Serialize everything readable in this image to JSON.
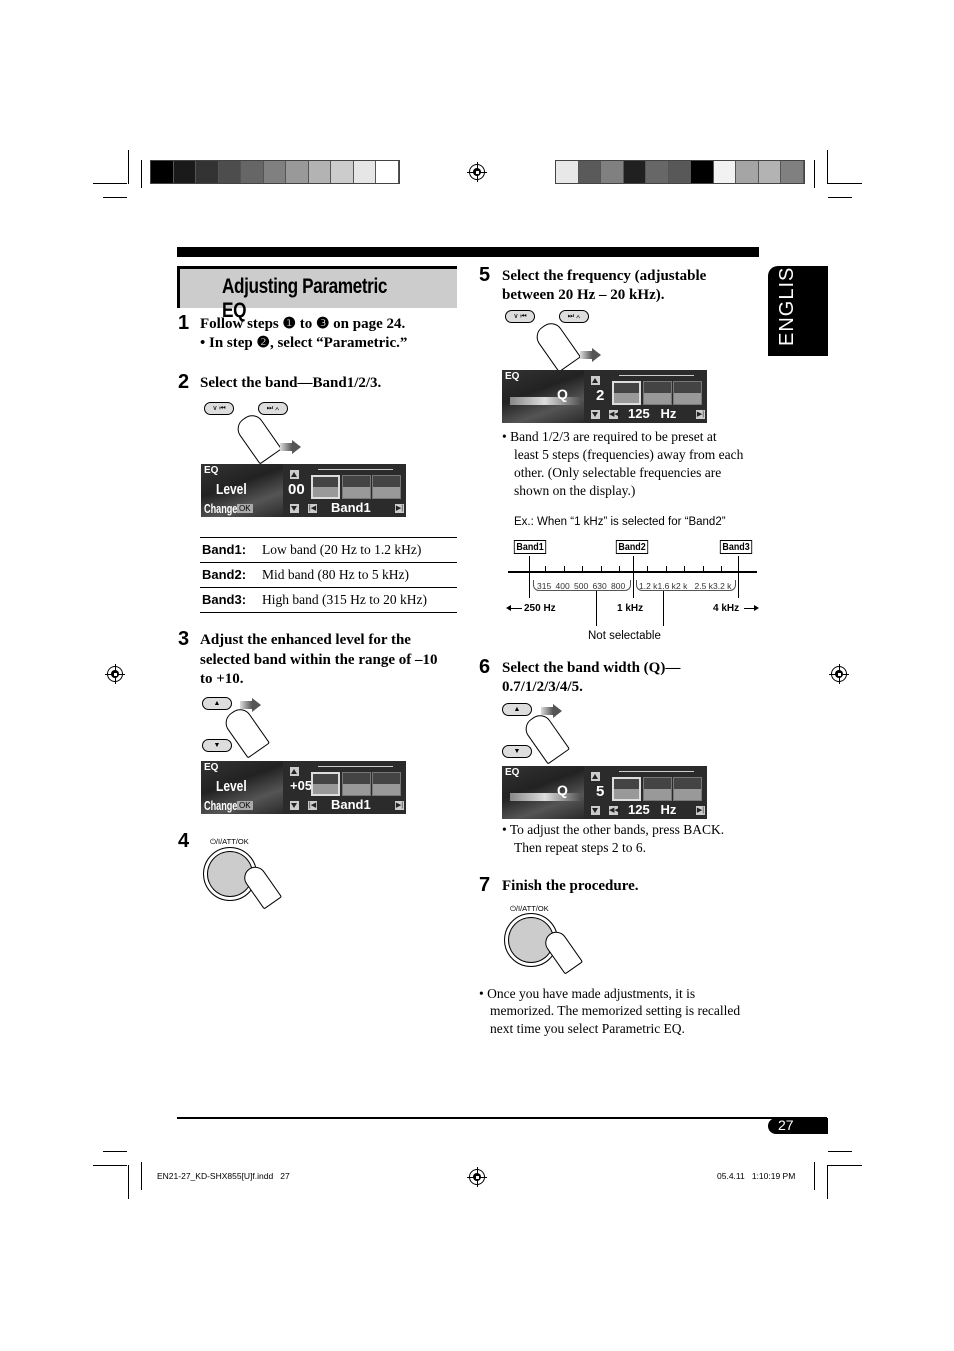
{
  "header": {
    "title": "Adjusting Parametric EQ",
    "language_tab": "ENGLISH",
    "color_bar_left": [
      "#000000",
      "#1a1a1a",
      "#333333",
      "#4d4d4d",
      "#666666",
      "#808080",
      "#999999",
      "#b3b3b3",
      "#cccccc",
      "#e6e6e6",
      "#ffffff"
    ],
    "color_bar_right": [
      "#e8e8e8",
      "#5a5a5a",
      "#808080",
      "#202020",
      "#676767",
      "#585858",
      "#000000",
      "#f2f2f2",
      "#a5a5a5",
      "#b3b3b3",
      "#808080"
    ]
  },
  "steps": [
    {
      "num": "1",
      "text": "Follow steps ❶ to ❸ on page 24.",
      "sub": "• In step ❷, select “Parametric.”"
    },
    {
      "num": "2",
      "text": "Select the band—Band1/2/3."
    },
    {
      "num": "3",
      "text_lines": [
        "Adjust the enhanced level for the",
        "selected band within the range of –10",
        "to +10."
      ]
    },
    {
      "num": "4",
      "knob_label": "⏻/I/ATT/OK"
    },
    {
      "num": "5",
      "text_lines": [
        "Select the frequency (adjustable",
        "between 20 Hz – 20 kHz)."
      ]
    },
    {
      "num": "6",
      "text_lines": [
        "Select the band width (Q)—",
        "0.7/1/2/3/4/5."
      ]
    },
    {
      "num": "7",
      "text": "Finish the procedure.",
      "knob_label": "⏻/I/ATT/OK"
    }
  ],
  "buttons": {
    "down_prev": "∨ ⏮",
    "next_up": "⏭ ∧",
    "up": "▲",
    "down": "▼"
  },
  "displays": {
    "step2": {
      "eq": "EQ",
      "mode": "Level",
      "change": "Change",
      "ok": "OK",
      "value": "00",
      "bottom": "Band1"
    },
    "step3": {
      "eq": "EQ",
      "mode": "Level",
      "change": "Change",
      "ok": "OK",
      "value": "+05",
      "bottom": "Band1"
    },
    "step5": {
      "eq": "EQ",
      "q": "Q",
      "value": "2",
      "bottom": "125   Hz"
    },
    "step6": {
      "eq": "EQ",
      "q": "Q",
      "value": "5",
      "bottom": "125   Hz"
    }
  },
  "band_table": [
    {
      "band": "Band1",
      "desc": "Low band (20 Hz to 1.2 kHz)"
    },
    {
      "band": "Band2",
      "desc": "Mid band (80 Hz to 5 kHz)"
    },
    {
      "band": "Band3",
      "desc": "High band (315 Hz to 20 kHz)"
    }
  ],
  "notes": {
    "step5_lines": [
      "•  Band 1/2/3 are required to be preset at",
      "least 5 steps (frequencies) away from each",
      "other. (Only selectable frequencies are",
      "shown on the display.)"
    ],
    "example": "Ex.: When “1 kHz” is selected for “Band2”",
    "step6_lines": [
      "•  To adjust the other bands, press BACK.",
      "Then repeat steps 2 to 6."
    ],
    "final_lines": [
      "•  Once you have made adjustments, it is",
      "memorized. The memorized setting is recalled",
      "next time you select Parametric EQ."
    ]
  },
  "freq_diagram": {
    "bands": [
      "Band1",
      "Band2",
      "Band3"
    ],
    "left_group": [
      "315",
      "400",
      "500",
      "630",
      "800"
    ],
    "right_group": [
      "1.2 k",
      "1.6 k",
      "2 k",
      "2.5 k",
      "3.2 k"
    ],
    "left_label": "250 Hz",
    "mid_label": "1 kHz",
    "right_label": "4 kHz",
    "not_selectable": "Not selectable"
  },
  "footer": {
    "page_number": "27",
    "file": "EN21-27_KD-SHX855[U]f.indd   27",
    "timestamp": "05.4.11   1:10:19 PM"
  }
}
